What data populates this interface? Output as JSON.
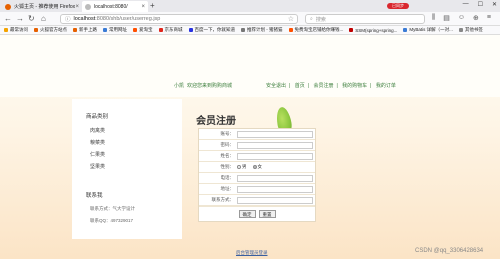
{
  "browser": {
    "tabs": [
      {
        "label": "火狐主页 - 推荐使用 Firefox",
        "color": "#e66000"
      },
      {
        "label": "localhost:8080/",
        "color": "#888888"
      }
    ],
    "new_tab": "+",
    "account_badge": "已同步",
    "url_host": "localhost",
    "url_path": ":8080/shb/user/userreg.jsp",
    "search_placeholder": "搜索"
  },
  "bookmarks": [
    {
      "label": "最常访问",
      "color": "#f4a300"
    },
    {
      "label": "火狐官方站点",
      "color": "#e66000"
    },
    {
      "label": "新手上路",
      "color": "#e66000"
    },
    {
      "label": "常用网址",
      "color": "#3a7bd5"
    },
    {
      "label": "爱淘宝",
      "color": "#ff5000"
    },
    {
      "label": "京东商城",
      "color": "#e1251b"
    },
    {
      "label": "百度一下，你就知道",
      "color": "#2932e1"
    },
    {
      "label": "推荐计划 - 猪猪猫",
      "color": "#777777"
    },
    {
      "label": "免费淘宝店铺给你赚钱...",
      "color": "#ff5000"
    },
    {
      "label": "SSM(spring+spring...",
      "color": "#c00000"
    },
    {
      "label": "MyBatis 详解（一对...",
      "color": "#3a7bd5"
    },
    {
      "label": "其他书签",
      "color": "#888888"
    }
  ],
  "top_links": {
    "greeting_user": "小凯",
    "greeting": "欢迎您来到购购商城",
    "logout": "安全退出",
    "home": "首页",
    "register": "会员注册",
    "cart": "我的购物车",
    "orders": "我的订单"
  },
  "sidebar": {
    "category_title": "商品类别",
    "categories": [
      "肉禽类",
      "粮菜类",
      "仁果类",
      "坚果类"
    ],
    "contact_title": "联系我",
    "contact_lines": [
      "联系方式：气大学设计",
      "联系QQ：497329017"
    ]
  },
  "form": {
    "title": "会员注册",
    "fields": [
      {
        "label": "账号："
      },
      {
        "label": "密码："
      },
      {
        "label": "姓名："
      },
      {
        "label": "性别："
      },
      {
        "label": "电话："
      },
      {
        "label": "地址："
      },
      {
        "label": "联系方式："
      }
    ],
    "gender_male": "男",
    "gender_female": "女",
    "gender_selected": "女",
    "submit": "确定",
    "reset": "重置"
  },
  "footer": {
    "admin_link": "后台管理员登录"
  },
  "watermark": "CSDN @qq_3306428634"
}
